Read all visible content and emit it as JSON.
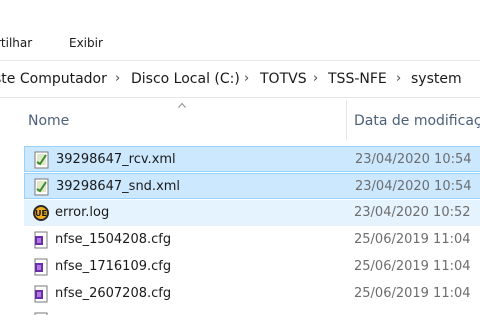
{
  "ribbon": {
    "tabs": [
      "rtilhar",
      "Exibir"
    ]
  },
  "address": {
    "crumbs": [
      "ste Computador",
      "Disco Local (C:)",
      "TOTVS",
      "TSS-NFE",
      "system"
    ]
  },
  "columns": {
    "name": "Nome",
    "date": "Data de modificaçã"
  },
  "files": [
    {
      "name": "39298647_rcv.xml",
      "date": "23/04/2020 10:54",
      "icon": "xml-file-icon",
      "state": "selected"
    },
    {
      "name": "39298647_snd.xml",
      "date": "23/04/2020 10:54",
      "icon": "xml-file-icon",
      "state": "selected"
    },
    {
      "name": "error.log",
      "date": "23/04/2020 10:52",
      "icon": "ultraedit-log-icon",
      "state": "hover"
    },
    {
      "name": "nfse_1504208.cfg",
      "date": "25/06/2019 11:04",
      "icon": "cfg-file-icon",
      "state": "normal"
    },
    {
      "name": "nfse_1716109.cfg",
      "date": "25/06/2019 11:04",
      "icon": "cfg-file-icon",
      "state": "normal"
    },
    {
      "name": "nfse_2607208.cfg",
      "date": "25/06/2019 11:04",
      "icon": "cfg-file-icon",
      "state": "normal"
    }
  ],
  "colors": {
    "selected_bg": "#cce8ff",
    "selected_border": "#99d1ff",
    "hover_bg": "#e5f3ff",
    "header_text": "#4c607a"
  }
}
